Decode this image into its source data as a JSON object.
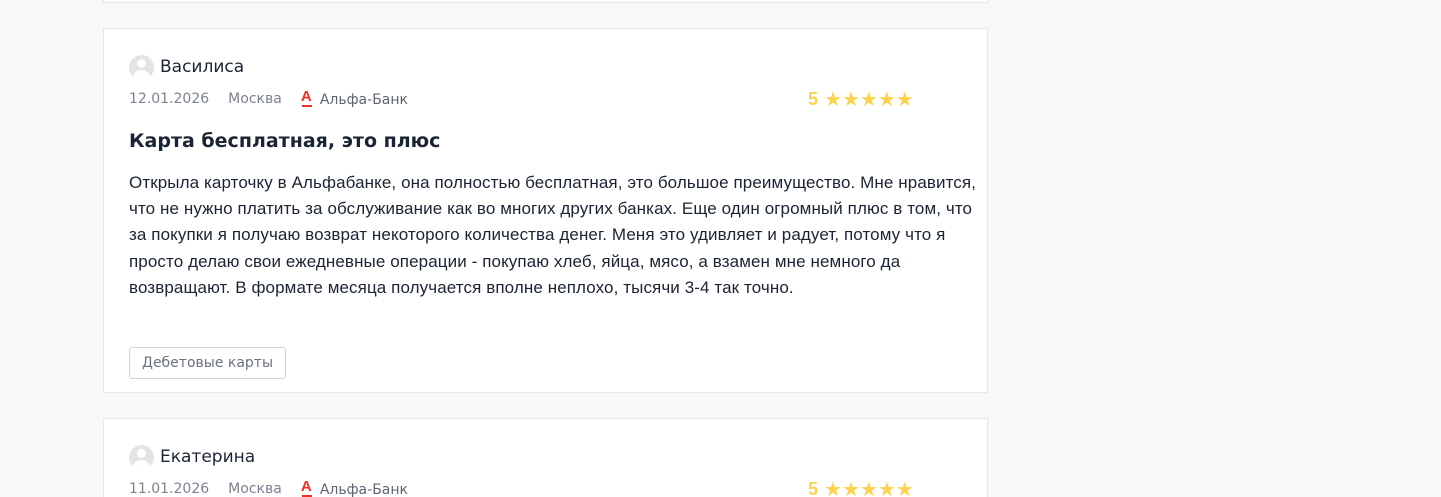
{
  "reviews": [
    {
      "author": "Василиса",
      "date": "12.01.2026",
      "city": "Москва",
      "bank": "Альфа-Банк",
      "bank_logo_letter": "А",
      "rating": "5",
      "stars": 5,
      "title": "Карта бесплатная, это плюс",
      "text": "Открыла карточку в Альфабанке, она полностью бесплатная, это большое преимущество. Мне нравится, что не нужно платить за обслуживание как во многих других банках. Еще один огромный плюс в том, что за покупки я получаю возврат некоторого количества денег. Меня это удивляет и радует, потому что я просто делаю свои ежедневные операции - покупаю хлеб, яйца, мясо, а взамен мне немного да возвращают. В формате месяца получается вполне неплохо, тысячи 3-4 так точно.",
      "tag": "Дебетовые карты"
    },
    {
      "author": "Екатерина",
      "date": "11.01.2026",
      "city": "Москва",
      "bank": "Альфа-Банк",
      "bank_logo_letter": "А",
      "rating": "5",
      "stars": 5
    }
  ],
  "colors": {
    "star": "#fcd34d",
    "bank_logo": "#ef3124",
    "card_border": "#e6e7eb",
    "background": "#f8f8f9"
  },
  "icons": {
    "avatar": "user-avatar-icon",
    "star": "star-icon",
    "bank_logo": "alfa-bank-logo"
  }
}
